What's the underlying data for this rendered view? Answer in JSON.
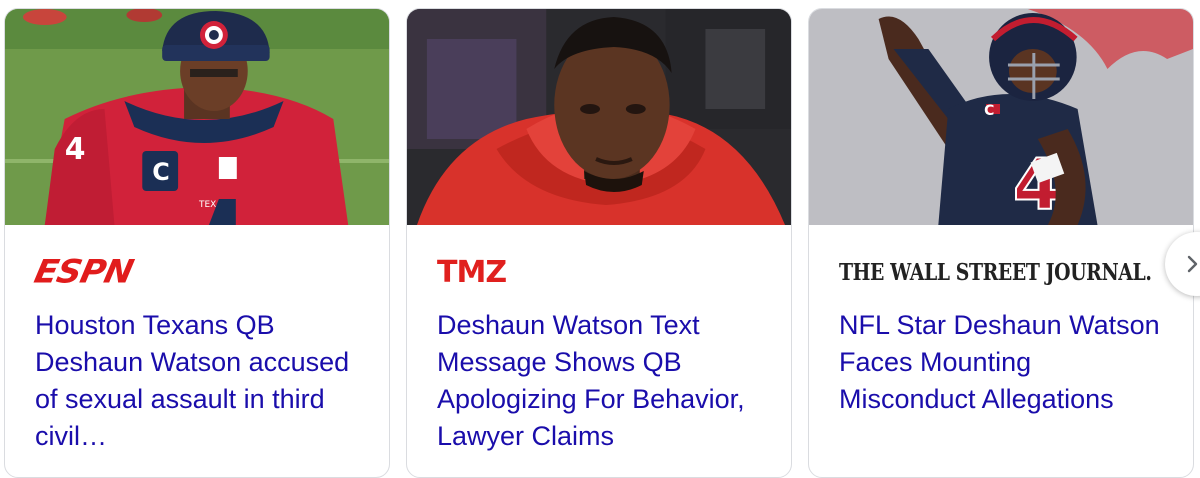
{
  "carousel": {
    "cards": [
      {
        "source": "ESPN",
        "source_logo_text": "ESPN",
        "headline": "Houston Texans QB Deshaun Watson accused of sexual assault in third civil…",
        "image": "football-player-texans-jersey"
      },
      {
        "source": "TMZ",
        "source_logo_text": "TMZ",
        "headline": "Deshaun Watson Text Message Shows QB Apologizing For Behavior, Lawyer Claims",
        "image": "man-red-hoodie"
      },
      {
        "source": "The Wall Street Journal",
        "source_logo_text": "THE WALL STREET JOURNAL.",
        "headline": "NFL Star Deshaun Watson Faces Mounting Misconduct Allegations",
        "image": "quarterback-throwing"
      }
    ],
    "next_button": {
      "icon": "chevron-right-icon"
    }
  },
  "colors": {
    "headline_link": "#1a0dab",
    "espn_red": "#e11c1c",
    "tmz_red": "#e0201e",
    "card_border": "#dadce0"
  }
}
